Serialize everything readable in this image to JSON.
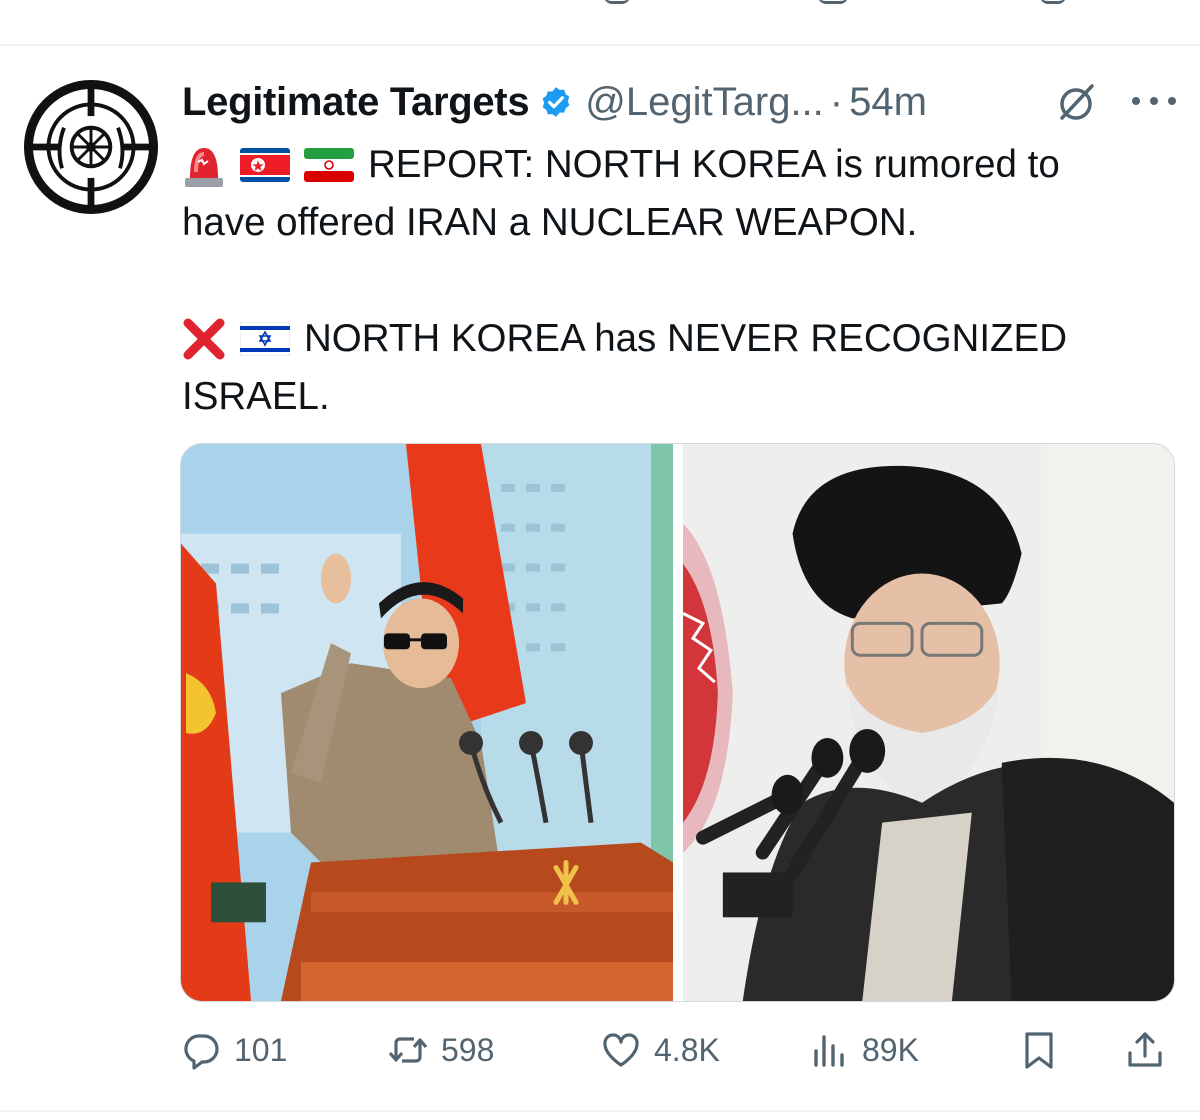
{
  "tweet": {
    "display_name": "Legitimate Targets",
    "handle": "@LegitTarg...",
    "separator": "·",
    "time": "54m",
    "lines": [
      [
        "🚨",
        "🇰🇵",
        "🇮🇷"
      ],
      "REPORT: NORTH KOREA is rumored to",
      "have offered IRAN a NUCLEAR WEAPON.",
      [
        "❌",
        "🇮🇱"
      ],
      "NORTH KOREA has NEVER RECOGNIZED",
      "ISRAEL."
    ]
  },
  "icons": {
    "avatar": "crosshair-wheel-logo",
    "verified": "verified-badge-icon",
    "grok": "grok-icon",
    "more": "more-icon",
    "reply": "reply-icon",
    "retweet": "retweet-icon",
    "like": "heart-icon",
    "views": "views-icon",
    "bookmark": "bookmark-icon",
    "share": "share-icon"
  },
  "actions": {
    "replies": "101",
    "retweets": "598",
    "likes": "4.8K",
    "views": "89K"
  },
  "colors": {
    "text": "#0f1419",
    "secondary": "#536471",
    "verified": "#1d9bf0",
    "divider": "#eff3f4"
  }
}
